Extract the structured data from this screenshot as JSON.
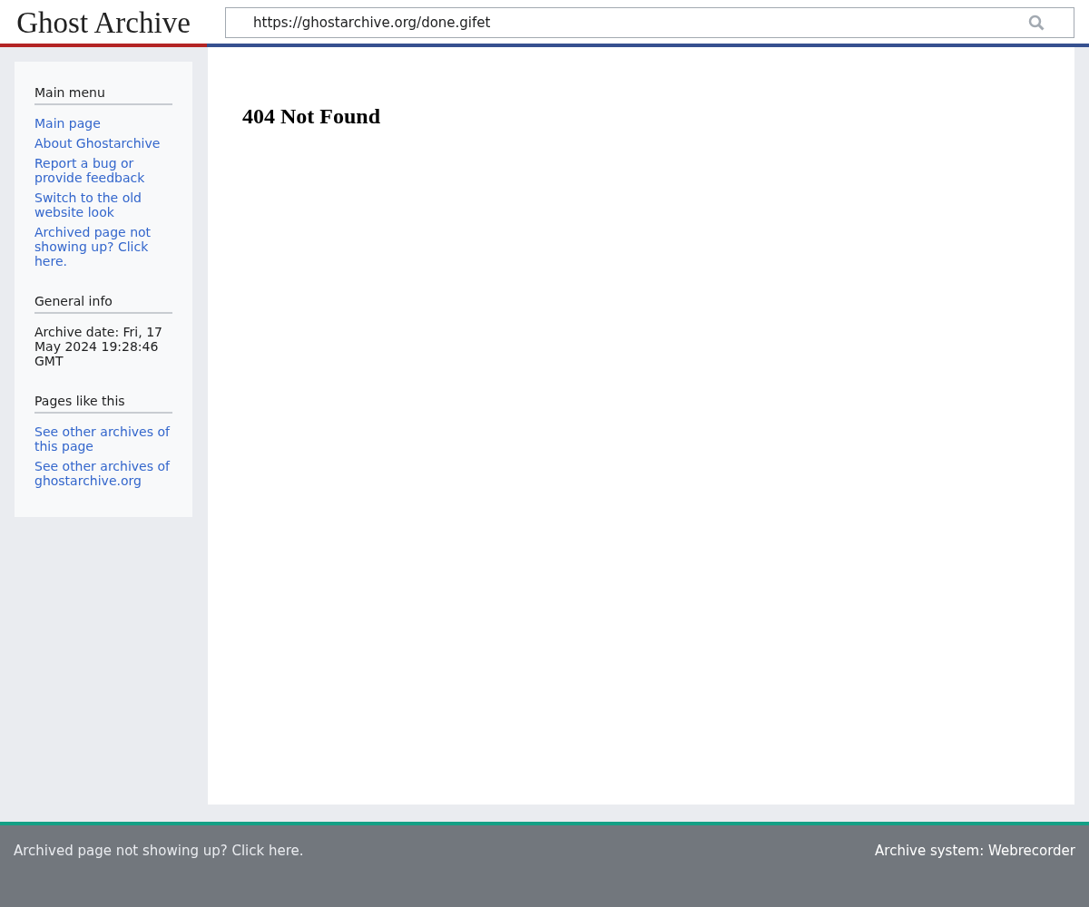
{
  "header": {
    "logo": "Ghost Archive",
    "search": {
      "value": "https://ghostarchive.org/done.gifet"
    }
  },
  "sidebar": {
    "sections": [
      {
        "title": "Main menu",
        "kind": "links",
        "items": [
          "Main page",
          "About Ghostarchive",
          "Report a bug or provide feedback",
          "Switch to the old website look",
          "Archived page not showing up? Click here."
        ]
      },
      {
        "title": "General info",
        "kind": "text",
        "items": [
          "Archive date: Fri, 17 May 2024 19:28:46 GMT"
        ]
      },
      {
        "title": "Pages like this",
        "kind": "links",
        "items": [
          "See other archives of this page",
          "See other archives of ghostarchive.org"
        ]
      }
    ]
  },
  "content": {
    "heading": "404 Not Found"
  },
  "footer": {
    "left": "Archived page not showing up? Click here.",
    "right": "Archive system: Webrecorder"
  }
}
